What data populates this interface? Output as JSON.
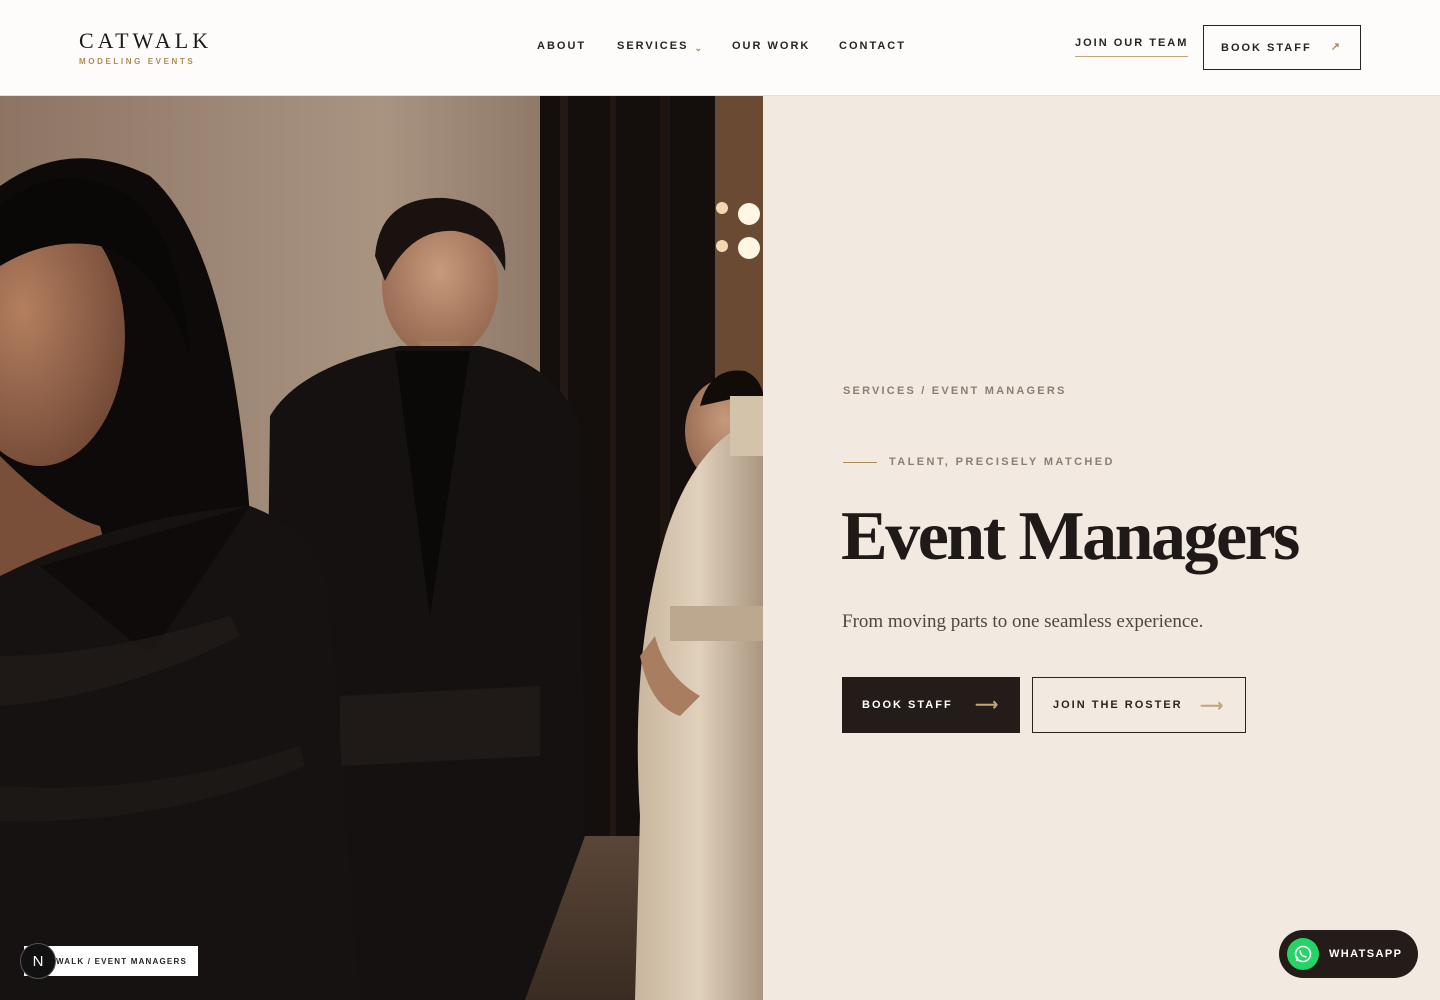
{
  "brand": {
    "name": "CATWALK",
    "tagline": "MODELING EVENTS"
  },
  "nav": {
    "items": [
      {
        "label": "ABOUT"
      },
      {
        "label": "SERVICES",
        "has_dropdown": true
      },
      {
        "label": "OUR WORK"
      },
      {
        "label": "CONTACT"
      }
    ]
  },
  "header_actions": {
    "join_team": "JOIN OUR TEAM",
    "book_staff": "BOOK STAFF"
  },
  "hero": {
    "breadcrumb": "SERVICES / EVENT MANAGERS",
    "eyebrow": "TALENT, PRECISELY MATCHED",
    "title": "Event Managers",
    "subtitle": "From moving parts to one seamless experience.",
    "primary_button": "BOOK STAFF",
    "secondary_button": "JOIN THE ROSTER"
  },
  "image_caption": "WALK / EVENT MANAGERS",
  "dev_badge": "N",
  "whatsapp": {
    "label": "WHATSAPP"
  },
  "colors": {
    "accent": "#b08a55",
    "dark": "#231c19",
    "panel": "#f2e9e1",
    "whatsapp": "#25d366"
  },
  "icons": [
    "chevron-down-icon",
    "arrow-up-right-icon",
    "arrow-right-icon",
    "whatsapp-icon"
  ]
}
